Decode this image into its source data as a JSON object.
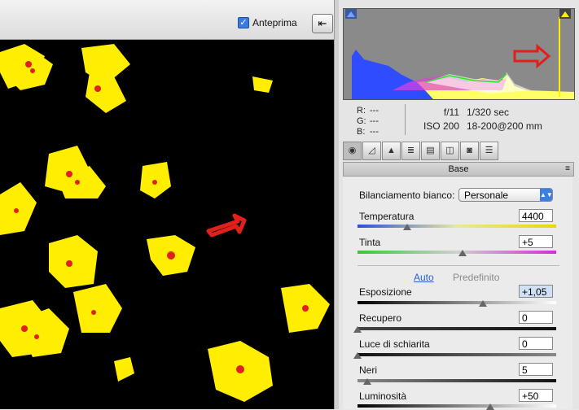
{
  "toolbar": {
    "preview_label": "Anteprima",
    "preview_checked": "✓",
    "fullscreen_icon": "fullscreen-toggle-icon"
  },
  "readout": {
    "r_label": "R:",
    "g_label": "G:",
    "b_label": "B:",
    "r_value": "---",
    "g_value": "---",
    "b_value": "---",
    "aperture": "f/11",
    "shutter": "1/320 sec",
    "iso": "ISO 200",
    "lens": "18-200@200 mm"
  },
  "tabs": [
    "camera-aperture-icon",
    "tone-curve-icon",
    "detail-icon",
    "hsl-icon",
    "split-toning-icon",
    "lens-corrections-icon",
    "camera-calibration-icon",
    "presets-icon"
  ],
  "section": {
    "title": "Base",
    "menu": "≡"
  },
  "white_balance": {
    "label": "Bilanciamento bianco:",
    "value": "Personale"
  },
  "sliders": [
    {
      "label": "Temperatura",
      "value": "4400",
      "level": 0.25
    },
    {
      "label": "Tinta",
      "value": "+5",
      "level": 0.53
    },
    {
      "label": "Esposizione",
      "value": "+1,05",
      "level": 0.63
    },
    {
      "label": "Recupero",
      "value": "0",
      "level": 0.0
    },
    {
      "label": "Luce di schiarita",
      "value": "0",
      "level": 0.0
    },
    {
      "label": "Neri",
      "value": "5",
      "level": 0.05
    },
    {
      "label": "Luminosità",
      "value": "+50",
      "level": 0.67
    }
  ],
  "auto_link": "Auto",
  "default_link": "Predefinito",
  "colors": {
    "accent": "#3b7fe3",
    "clip_warning": "#ffee00",
    "arrow": "#e0201a"
  }
}
